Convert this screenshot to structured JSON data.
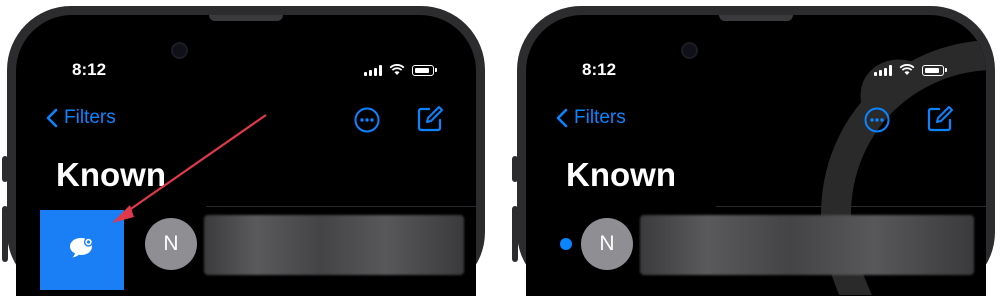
{
  "colors": {
    "accent": "#0a84ff",
    "swipe_action": "#1a7ff5",
    "arrow": "#e0394b",
    "background": "#000000",
    "avatar": "#8e8e93"
  },
  "left_phone": {
    "status_bar": {
      "time": "8:12",
      "icons": [
        "signal-icon",
        "wifi-icon",
        "battery-icon"
      ]
    },
    "nav": {
      "back_label": "Filters",
      "more_icon": "ellipsis-circle-icon",
      "compose_icon": "compose-icon"
    },
    "title": "Known",
    "conversation": {
      "avatar_initial": "N",
      "swipe_action_icon": "unread-bubble-icon"
    }
  },
  "right_phone": {
    "status_bar": {
      "time": "8:12",
      "icons": [
        "signal-icon",
        "wifi-icon",
        "battery-icon"
      ]
    },
    "nav": {
      "back_label": "Filters",
      "more_icon": "ellipsis-circle-icon",
      "compose_icon": "compose-icon"
    },
    "title": "Known",
    "conversation": {
      "avatar_initial": "N",
      "unread_indicator": true
    }
  }
}
